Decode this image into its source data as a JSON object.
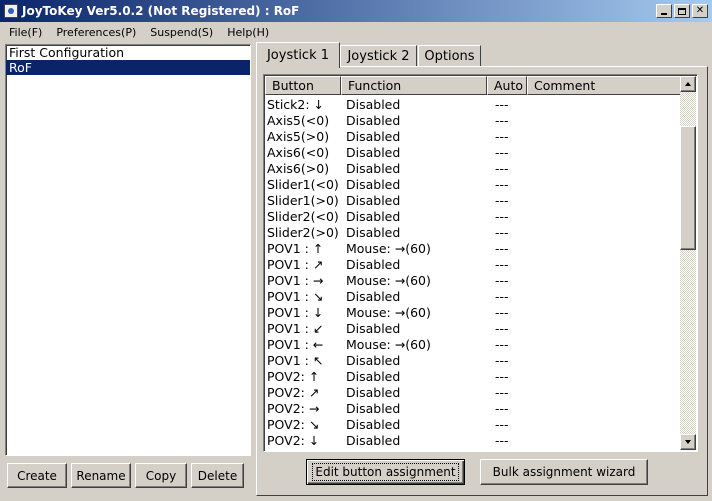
{
  "window": {
    "title": "JoyToKey Ver5.0.2 (Not Registered) : RoF"
  },
  "menu": [
    "File(F)",
    "Preferences(P)",
    "Suspend(S)",
    "Help(H)"
  ],
  "configs": [
    {
      "label": "First Configuration",
      "selected": false
    },
    {
      "label": "RoF",
      "selected": true
    }
  ],
  "left_buttons": {
    "create": "Create",
    "rename": "Rename",
    "copy": "Copy",
    "delete": "Delete"
  },
  "tabs": [
    {
      "label": "Joystick 1",
      "active": true
    },
    {
      "label": "Joystick 2",
      "active": false
    },
    {
      "label": "Options",
      "active": false
    }
  ],
  "grid": {
    "columns": [
      "Button",
      "Function",
      "Auto",
      "Comment"
    ],
    "rows": [
      {
        "button": "Stick2: ↓",
        "function": "Disabled",
        "auto": "---",
        "comment": ""
      },
      {
        "button": "Axis5(<0)",
        "function": "Disabled",
        "auto": "---",
        "comment": ""
      },
      {
        "button": "Axis5(>0)",
        "function": "Disabled",
        "auto": "---",
        "comment": ""
      },
      {
        "button": "Axis6(<0)",
        "function": "Disabled",
        "auto": "---",
        "comment": ""
      },
      {
        "button": "Axis6(>0)",
        "function": "Disabled",
        "auto": "---",
        "comment": ""
      },
      {
        "button": "Slider1(<0)",
        "function": "Disabled",
        "auto": "---",
        "comment": ""
      },
      {
        "button": "Slider1(>0)",
        "function": "Disabled",
        "auto": "---",
        "comment": ""
      },
      {
        "button": "Slider2(<0)",
        "function": "Disabled",
        "auto": "---",
        "comment": ""
      },
      {
        "button": "Slider2(>0)",
        "function": "Disabled",
        "auto": "---",
        "comment": ""
      },
      {
        "button": "POV1 : ↑",
        "function": "Mouse: →(60)",
        "auto": "---",
        "comment": ""
      },
      {
        "button": "POV1 : ↗",
        "function": "Disabled",
        "auto": "---",
        "comment": ""
      },
      {
        "button": "POV1 : →",
        "function": "Mouse: →(60)",
        "auto": "---",
        "comment": ""
      },
      {
        "button": "POV1 : ↘",
        "function": "Disabled",
        "auto": "---",
        "comment": ""
      },
      {
        "button": "POV1 : ↓",
        "function": "Mouse: →(60)",
        "auto": "---",
        "comment": ""
      },
      {
        "button": "POV1 : ↙",
        "function": "Disabled",
        "auto": "---",
        "comment": ""
      },
      {
        "button": "POV1 : ←",
        "function": "Mouse: →(60)",
        "auto": "---",
        "comment": ""
      },
      {
        "button": "POV1 : ↖",
        "function": "Disabled",
        "auto": "---",
        "comment": ""
      },
      {
        "button": "POV2: ↑",
        "function": "Disabled",
        "auto": "---",
        "comment": ""
      },
      {
        "button": "POV2: ↗",
        "function": "Disabled",
        "auto": "---",
        "comment": ""
      },
      {
        "button": "POV2: →",
        "function": "Disabled",
        "auto": "---",
        "comment": ""
      },
      {
        "button": "POV2: ↘",
        "function": "Disabled",
        "auto": "---",
        "comment": ""
      },
      {
        "button": "POV2: ↓",
        "function": "Disabled",
        "auto": "---",
        "comment": ""
      }
    ]
  },
  "bottom_buttons": {
    "edit": "Edit button assignment",
    "bulk": "Bulk assignment wizard"
  },
  "colors": {
    "title_gradient_start": "#0a246a",
    "title_gradient_end": "#a6caf0",
    "selection": "#0a246a",
    "face": "#d4d0c8"
  }
}
